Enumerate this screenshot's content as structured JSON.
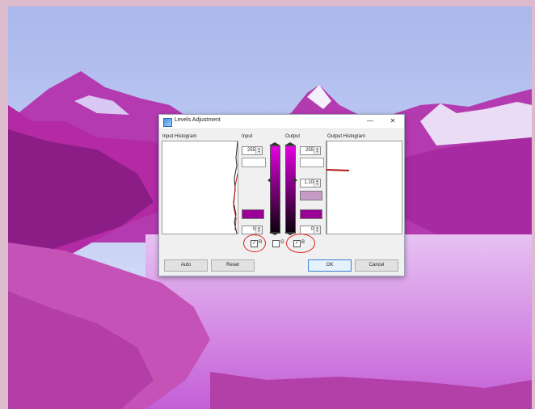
{
  "dialog": {
    "title": "Levels Adjustment",
    "minimize_glyph": "—",
    "close_glyph": "✕"
  },
  "labels": {
    "input_histogram": "Input Histogram",
    "input": "Input",
    "output": "Output",
    "output_histogram": "Output Histogram"
  },
  "input_spins": {
    "top": "255",
    "bottom": "0"
  },
  "output_spins": {
    "top": "255",
    "gamma": "1.10",
    "bottom": "0"
  },
  "checkboxes": {
    "left_label": "R",
    "middle_label": "G",
    "right_label": "B",
    "checked_mark": "✓"
  },
  "buttons": {
    "auto": "Auto",
    "reset": "Reset",
    "ok": "OK",
    "cancel": "Cancel"
  },
  "colors": {
    "accent_magenta": "#a0009c",
    "annotation_red": "#e02020",
    "swatch_mauve": "#c89ac8"
  }
}
